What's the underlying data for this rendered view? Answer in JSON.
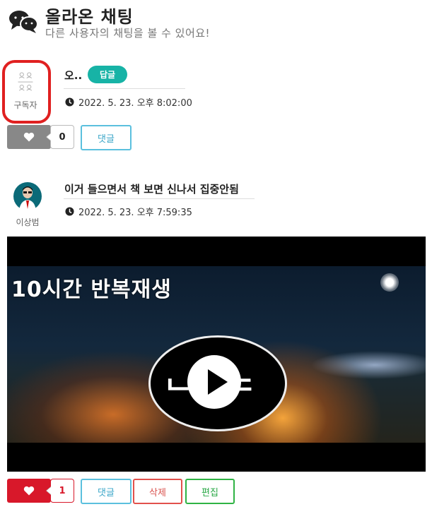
{
  "header": {
    "title": "올라온 채팅",
    "subtitle": "다른 사용자의 채팅을 볼 수 있어요!",
    "icon": "chat-bubbles-icon"
  },
  "posts": [
    {
      "author": "구독자",
      "title": "오..",
      "reply_badge": "답글",
      "timestamp": "2022. 5. 23. 오후 8:02:00",
      "like_count": "0",
      "liked": false,
      "buttons": {
        "comment": "댓글"
      }
    },
    {
      "author": "이상범",
      "title": "이거 들으면서 책 보면 신나서 집중안됨",
      "timestamp": "2022. 5. 23. 오후 7:59:35",
      "video": {
        "thumbnail_text": "10시간 반복재생",
        "logo_text": "ᄂᄂᄃ"
      },
      "like_count": "1",
      "liked": true,
      "buttons": {
        "comment": "댓글",
        "delete": "삭제",
        "edit": "편집"
      }
    }
  ],
  "colors": {
    "reply_badge": "#17b3a6",
    "like_inactive": "#888888",
    "like_active": "#d8182a",
    "comment_border": "#5bc0de",
    "delete_border": "#e2514c",
    "edit_border": "#2fb344",
    "highlight_ring": "#e02020"
  }
}
